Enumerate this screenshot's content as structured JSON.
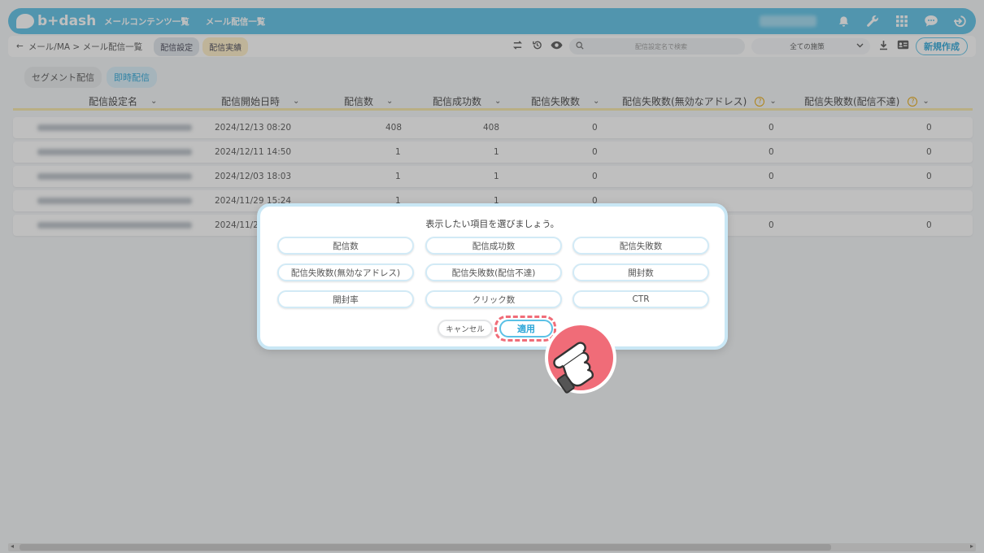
{
  "header": {
    "logo_text": "b+dash",
    "nav": [
      "メールコンテンツ一覧",
      "メール配信一覧"
    ],
    "icons": [
      "bell-icon",
      "wrench-icon",
      "grid-icon",
      "chat-icon",
      "logout-icon"
    ]
  },
  "subbar": {
    "back_glyph": "←",
    "breadcrumb": "メール/MA > メール配信一覧",
    "tabs": [
      "配信設定",
      "配信実績"
    ],
    "active_tab_index": 1,
    "search_placeholder": "配信設定名で検索",
    "filter_select": "全ての施策",
    "new_button": "新規作成"
  },
  "segment_tabs": [
    "セグメント配信",
    "即時配信"
  ],
  "active_segment_index": 1,
  "table": {
    "columns": [
      "配信設定名",
      "配信開始日時",
      "配信数",
      "配信成功数",
      "配信失敗数",
      "配信失敗数(無効なアドレス)",
      "配信失敗数(配信不達)"
    ],
    "rows": [
      {
        "date": "2024/12/13 08:20",
        "sent": "408",
        "success": "408",
        "failed": "0",
        "invalid": "0",
        "undelivered": "0"
      },
      {
        "date": "2024/12/11 14:50",
        "sent": "1",
        "success": "1",
        "failed": "0",
        "invalid": "0",
        "undelivered": "0"
      },
      {
        "date": "2024/12/03 18:03",
        "sent": "1",
        "success": "1",
        "failed": "0",
        "invalid": "0",
        "undelivered": "0"
      },
      {
        "date": "2024/11/29 15:24",
        "sent": "1",
        "success": "1",
        "failed": "0",
        "invalid": "",
        "undelivered": ""
      },
      {
        "date": "2024/11/2",
        "sent": "",
        "success": "",
        "failed": "",
        "invalid": "0",
        "undelivered": "0"
      }
    ]
  },
  "modal": {
    "title": "表示したい項目を選びましょう。",
    "options": [
      "配信数",
      "配信成功数",
      "配信失敗数",
      "配信失敗数(無効なアドレス)",
      "配信失敗数(配信不達)",
      "開封数",
      "開封率",
      "クリック数",
      "CTR"
    ],
    "cancel_label": "キャンセル",
    "apply_label": "適用"
  },
  "colors": {
    "accent": "#5bc1e6",
    "highlight_ring": "#f06c78",
    "pointer_bg": "#f06c78"
  }
}
